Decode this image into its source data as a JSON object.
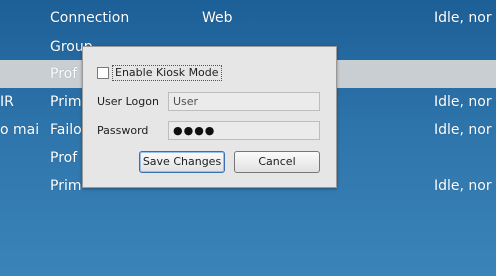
{
  "background": {
    "rows": [
      {
        "col0": "",
        "col1": "Connection",
        "col2": "Web",
        "col3": "Idle, nor",
        "selected": false
      },
      {
        "col0": "",
        "col1": "Group",
        "col2": "",
        "col3": "",
        "selected": false
      },
      {
        "col0": "",
        "col1": "Prof",
        "col2": "",
        "col3": "",
        "selected": true
      },
      {
        "col0": "IR",
        "col1": "Prim",
        "col2": "",
        "col3": "Idle, nor",
        "selected": false
      },
      {
        "col0": "o mai",
        "col1": "Failo",
        "col2": "",
        "col3": "Idle, nor",
        "selected": false
      },
      {
        "col0": "",
        "col1": "Prof",
        "col2": "",
        "col3": "",
        "selected": false
      },
      {
        "col0": "",
        "col1": "Prim",
        "col2": "",
        "col3": "Idle, nor",
        "selected": false
      }
    ]
  },
  "dialog": {
    "kiosk_checkbox_label": "Enable Kiosk Mode",
    "kiosk_checked": false,
    "user_logon_label": "User Logon",
    "user_logon_value": "User",
    "password_label": "Password",
    "password_value": "●●●●",
    "save_button": "Save Changes",
    "cancel_button": "Cancel"
  },
  "colors": {
    "background_top": "#1d5f97",
    "background_bottom": "#3a84b8",
    "selected_row": "#c9ced3",
    "dialog_bg": "#e6e6e6"
  }
}
